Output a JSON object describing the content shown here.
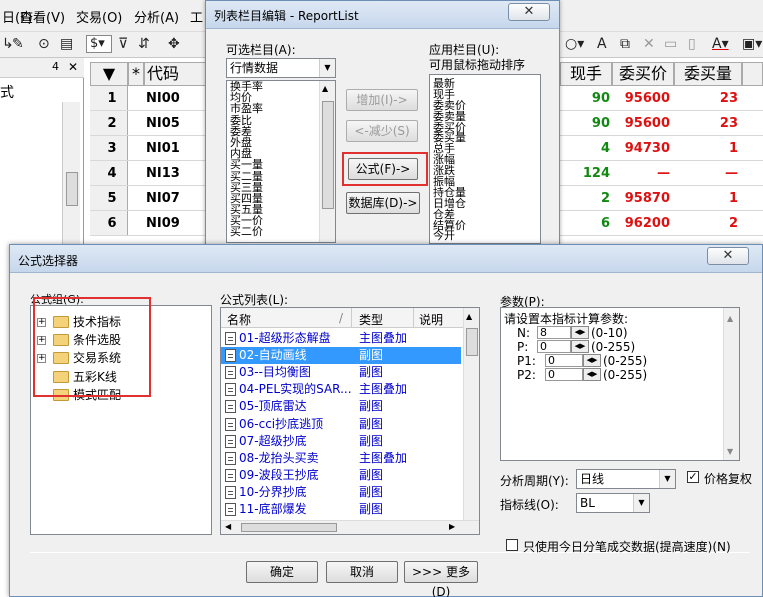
{
  "menubar": {
    "items": [
      "日(F)",
      "查看(V)",
      "交易(O)",
      "分析(A)",
      "工"
    ]
  },
  "grid": {
    "headers": [
      "*",
      "代码",
      "现手",
      "委买价",
      "委买量"
    ],
    "rows": [
      {
        "n": "1",
        "code": "NI00",
        "hand": "90",
        "price": "95600",
        "vol": "23"
      },
      {
        "n": "2",
        "code": "NI05",
        "hand": "90",
        "price": "95600",
        "vol": "23"
      },
      {
        "n": "3",
        "code": "NI01",
        "hand": "4",
        "price": "94730",
        "vol": "1"
      },
      {
        "n": "4",
        "code": "NI13",
        "hand": "124",
        "price": "—",
        "vol": "—"
      },
      {
        "n": "5",
        "code": "NI07",
        "hand": "2",
        "price": "95870",
        "vol": "1"
      },
      {
        "n": "6",
        "code": "NI09",
        "hand": "6",
        "price": "96200",
        "vol": "2"
      }
    ],
    "colors": {
      "green": "#118811",
      "red": "#dd1111"
    }
  },
  "left_pane": {
    "text": "式",
    "pin": "4",
    "close": "✕"
  },
  "columns_dialog": {
    "title": "列表栏目编辑 - ReportList",
    "available_label": "可选栏目(A):",
    "category": "行情数据",
    "available_items": [
      "换手率",
      "均价",
      "市盈率",
      "委比",
      "委差",
      "外盘",
      "内盘",
      "买一量",
      "买二量",
      "买三量",
      "买四量",
      "买五量",
      "买一价",
      "买二价"
    ],
    "add_button": "增加(I)->",
    "remove_button": "<-减少(S)",
    "formula_button": "公式(F)->",
    "database_button": "数据库(D)->",
    "applied_label": "应用栏目(U):",
    "applied_hint": "可用鼠标拖动排序",
    "applied_items": [
      "最新",
      "现手",
      "委卖价",
      "委卖量",
      "委买价",
      "委买量",
      "总手",
      "涨幅",
      "涨跌",
      "振幅",
      "持仓量",
      "日增仓",
      "仓差",
      "结算价",
      "今开"
    ]
  },
  "formula_dialog": {
    "title": "公式选择器",
    "group_label": "公式组(G):",
    "groups": [
      {
        "label": "技术指标",
        "expandable": true
      },
      {
        "label": "条件选股",
        "expandable": true
      },
      {
        "label": "交易系统",
        "expandable": true
      },
      {
        "label": "五彩K线",
        "expandable": false
      },
      {
        "label": "模式匹配",
        "expandable": false
      }
    ],
    "list_label": "公式列表(L):",
    "columns": [
      "名称",
      "类型",
      "说明"
    ],
    "formulas": [
      {
        "name": "01-超级形态解盘",
        "type": "主图叠加"
      },
      {
        "name": "02-自动画线",
        "type": "副图"
      },
      {
        "name": "03--目均衡图",
        "type": "副图"
      },
      {
        "name": "04-PEL实现的SAR...",
        "type": "主图叠加"
      },
      {
        "name": "05-顶底雷达",
        "type": "副图"
      },
      {
        "name": "06-cci抄底逃顶",
        "type": "副图"
      },
      {
        "name": "07-超级抄底",
        "type": "副图"
      },
      {
        "name": "08-龙抬头买卖",
        "type": "主图叠加"
      },
      {
        "name": "09-波段王抄底",
        "type": "副图"
      },
      {
        "name": "10-分界抄底",
        "type": "副图"
      },
      {
        "name": "11-底部爆发",
        "type": "副图"
      }
    ],
    "selected_index": 1,
    "params_label": "参数(P):",
    "params_hint": "请设置本指标计算参数:",
    "params": [
      {
        "name": "N:",
        "value": "8",
        "range": "(0-10)"
      },
      {
        "name": "P:",
        "value": "0",
        "range": "(0-255)"
      },
      {
        "name": "P1:",
        "value": "0",
        "range": "(0-255)"
      },
      {
        "name": "P2:",
        "value": "0",
        "range": "(0-255)"
      }
    ],
    "period_label": "分析周期(Y):",
    "period_value": "日线",
    "price_adjust_label": "价格复权",
    "price_adjust_checked": true,
    "indicator_line_label": "指标线(O):",
    "indicator_line_value": "BL",
    "tick_only_label": "只使用今日分笔成交数据(提高速度)(N)",
    "tick_only_checked": false,
    "ok_button": "确定",
    "cancel_button": "取消",
    "more_button": ">>> 更多(D)",
    "close_glyph": "✕"
  },
  "accent": {
    "selection": "#3399ff",
    "highlight": "#e03030"
  }
}
